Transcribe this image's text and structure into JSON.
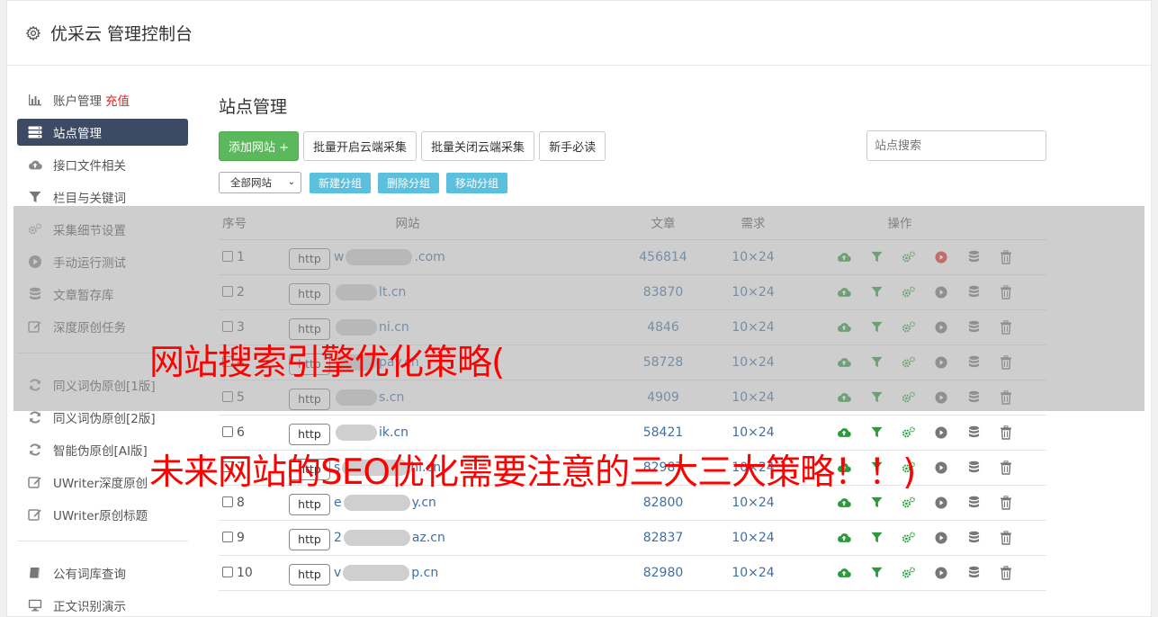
{
  "header": {
    "title": "优采云 管理控制台",
    "icon": "gear-icon"
  },
  "sidebar": {
    "group1": [
      {
        "label": "账户管理",
        "badge": "充值",
        "icon": "bar-chart-icon"
      },
      {
        "label": "站点管理",
        "icon": "server-icon",
        "active": true
      },
      {
        "label": "接口文件相关",
        "icon": "cloud-upload-icon"
      },
      {
        "label": "栏目与关键词",
        "icon": "filter-icon"
      },
      {
        "label": "采集细节设置",
        "icon": "gears-icon"
      },
      {
        "label": "手动运行测试",
        "icon": "play-circle-icon"
      },
      {
        "label": "文章暂存库",
        "icon": "database-icon"
      },
      {
        "label": "深度原创任务",
        "icon": "edit-icon"
      }
    ],
    "group2": [
      {
        "label": "同义词伪原创[1版]",
        "icon": "refresh-icon"
      },
      {
        "label": "同义词伪原创[2版]",
        "icon": "refresh-icon"
      },
      {
        "label": "智能伪原创[AI版]",
        "icon": "refresh-icon"
      },
      {
        "label": "UWriter深度原创",
        "icon": "edit-icon"
      },
      {
        "label": "UWriter原创标题",
        "icon": "edit-icon"
      }
    ],
    "group3": [
      {
        "label": "公有词库查询",
        "icon": "book-icon"
      },
      {
        "label": "正文识别演示",
        "icon": "monitor-icon"
      }
    ]
  },
  "main": {
    "title": "站点管理",
    "buttons": {
      "add": "添加网站 +",
      "batch_open": "批量开启云端采集",
      "batch_close": "批量关闭云端采集",
      "guide": "新手必读"
    },
    "search_placeholder": "站点搜索",
    "group_select": "全部网站",
    "group_buttons": [
      "新建分组",
      "删除分组",
      "移动分组"
    ],
    "table": {
      "headers": [
        "序号",
        "网站",
        "文章",
        "需求",
        "操作"
      ],
      "rows": [
        {
          "no": "1",
          "prefix": "w",
          "suffix": ".com",
          "articles": "456814",
          "demand": "10×24",
          "running": true
        },
        {
          "no": "2",
          "prefix": "",
          "suffix": "lt.cn",
          "articles": "83870",
          "demand": "10×24",
          "running": false
        },
        {
          "no": "3",
          "prefix": "",
          "suffix": "ni.cn",
          "articles": "4846",
          "demand": "10×24",
          "running": false
        },
        {
          "no": "4",
          "prefix": "",
          "suffix": "pay.cn",
          "articles": "58728",
          "demand": "10×24",
          "running": false
        },
        {
          "no": "5",
          "prefix": "",
          "suffix": "s.cn",
          "articles": "4909",
          "demand": "10×24",
          "running": false
        },
        {
          "no": "6",
          "prefix": "",
          "suffix": "ik.cn",
          "articles": "58421",
          "demand": "10×24",
          "running": false
        },
        {
          "no": "7",
          "prefix": "s",
          "suffix": "hl.cn",
          "articles": "82987",
          "demand": "10×24",
          "running": false
        },
        {
          "no": "8",
          "prefix": "e",
          "suffix": "y.cn",
          "articles": "82800",
          "demand": "10×24",
          "running": false
        },
        {
          "no": "9",
          "prefix": "2",
          "suffix": "az.cn",
          "articles": "82837",
          "demand": "10×24",
          "running": false
        },
        {
          "no": "10",
          "prefix": "v",
          "suffix": "p.cn",
          "articles": "82980",
          "demand": "10×24",
          "running": false
        }
      ],
      "http_label": "http"
    }
  },
  "overlay": {
    "line1": "网站搜索引擎优化策略(",
    "line2": "未来网站的SEO优化需要注意的三大三大策略！！)"
  },
  "colors": {
    "accent_green": "#5cb85c",
    "info_blue": "#5bc0de",
    "active_nav": "#3c4a63",
    "overlay_text": "#ff0000"
  }
}
